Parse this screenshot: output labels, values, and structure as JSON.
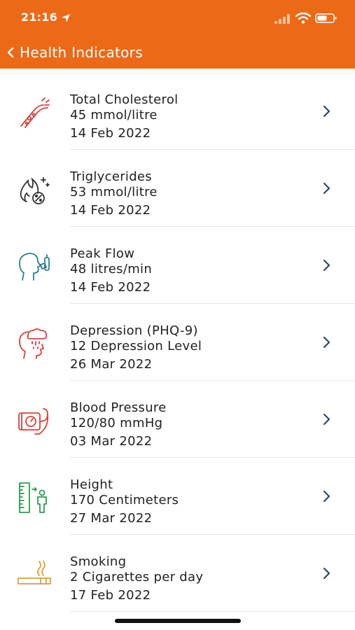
{
  "status": {
    "time": "21:16"
  },
  "nav": {
    "back_label": "Health Indicators"
  },
  "indicators": [
    {
      "name": "Total Cholesterol",
      "value": "45 mmol/litre",
      "date": "14 Feb 2022",
      "icon": "cholesterol-icon"
    },
    {
      "name": "Triglycerides",
      "value": "53 mmol/litre",
      "date": "14 Feb 2022",
      "icon": "triglycerides-icon"
    },
    {
      "name": "Peak Flow",
      "value": "48 litres/min",
      "date": "14 Feb 2022",
      "icon": "peak-flow-icon"
    },
    {
      "name": "Depression (PHQ-9)",
      "value": "12 Depression Level",
      "date": "26 Mar 2022",
      "icon": "depression-icon"
    },
    {
      "name": "Blood Pressure",
      "value": "120/80 mmHg",
      "date": "03 Mar 2022",
      "icon": "blood-pressure-icon"
    },
    {
      "name": "Height",
      "value": "170 Centimeters",
      "date": "27 Mar 2022",
      "icon": "height-icon"
    },
    {
      "name": "Smoking",
      "value": "2 Cigarettes per day",
      "date": "17 Feb 2022",
      "icon": "smoking-icon"
    }
  ],
  "colors": {
    "header": "#ec6a17",
    "cholesterol": "#d9433a",
    "triglycerides": "#333333",
    "peak_flow": "#2b7f8f",
    "depression": "#d9433a",
    "blood_pressure": "#d9433a",
    "height": "#2f9a53",
    "smoking": "#e1a12a",
    "chevron": "#2f4a66"
  }
}
